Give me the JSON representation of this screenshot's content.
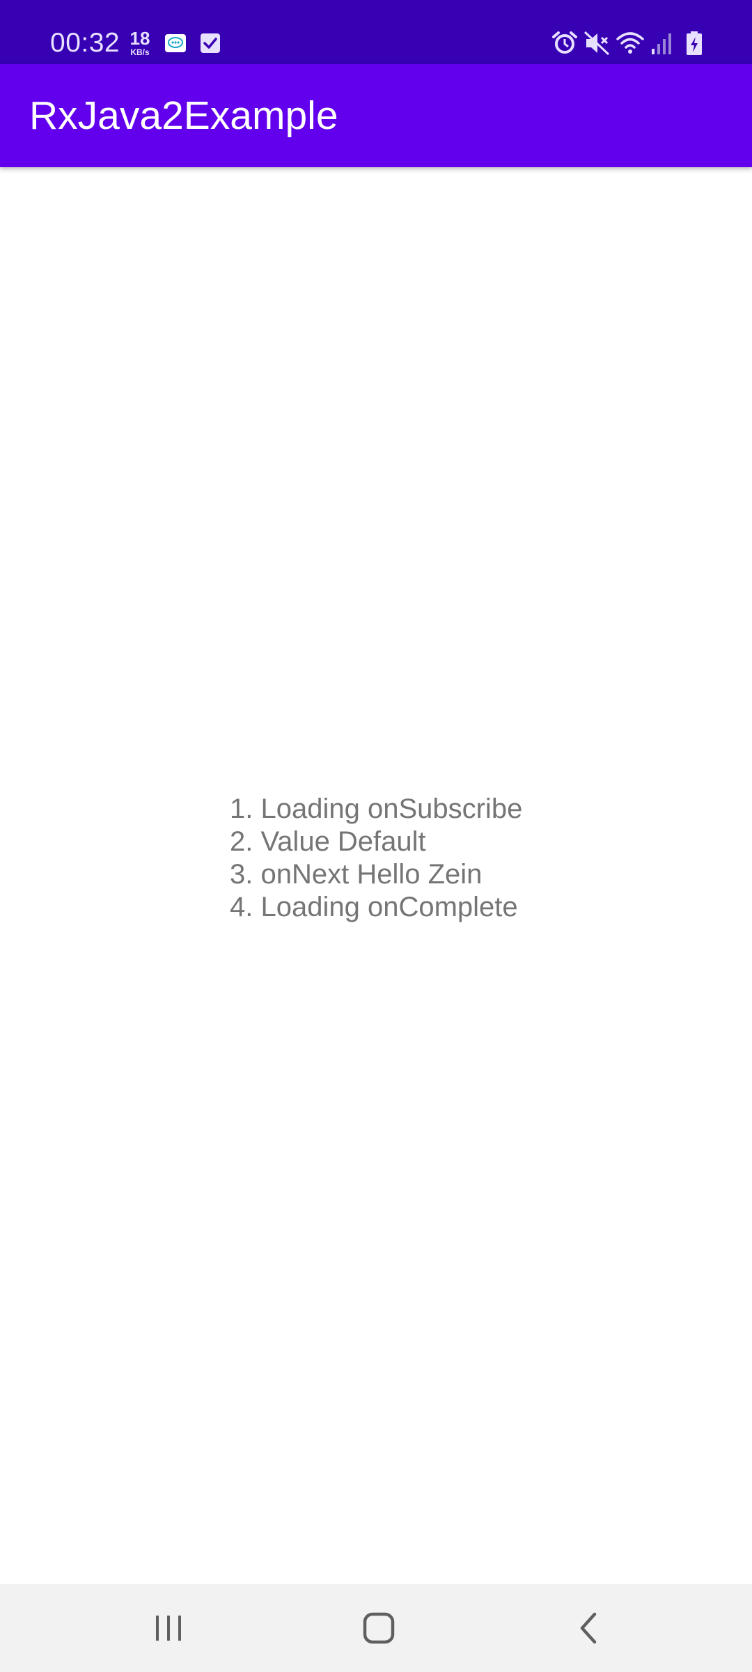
{
  "status_bar": {
    "time": "00:32",
    "net_speed_value": "18",
    "net_speed_unit": "KB/s",
    "notification_icons": [
      "kakao-icon",
      "checkbox-icon"
    ],
    "system_icons": [
      "alarm-icon",
      "mute-icon",
      "wifi-icon",
      "signal-icon",
      "battery-charging-icon"
    ],
    "background": "#3700b3"
  },
  "app_bar": {
    "title": "RxJava2Example",
    "background": "#6200ee"
  },
  "main": {
    "log_lines": [
      "1. Loading onSubscribe",
      "2. Value Default",
      "3. onNext Hello Zein",
      "4. Loading onComplete"
    ]
  },
  "nav_bar": {
    "buttons": [
      "recents-icon",
      "home-icon",
      "back-icon"
    ]
  }
}
